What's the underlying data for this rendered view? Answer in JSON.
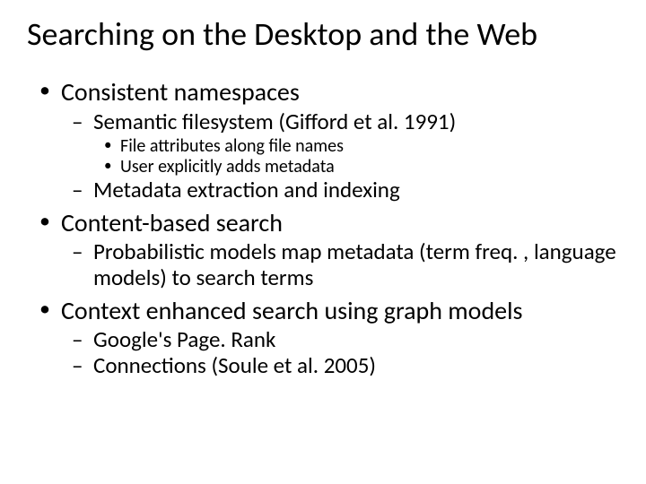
{
  "title": "Searching on the Desktop and the Web",
  "b1": {
    "text": "Consistent namespaces",
    "sub": {
      "s1": {
        "text": "Semantic filesystem (Gifford et al. 1991)",
        "sub": {
          "a": "File attributes along file names",
          "b": "User explicitly adds metadata"
        }
      },
      "s2": {
        "text": "Metadata extraction and indexing"
      }
    }
  },
  "b2": {
    "text": "Content-based search",
    "sub": {
      "s1": {
        "text": "Probabilistic models map metadata (term freq. , language models) to search terms"
      }
    }
  },
  "b3": {
    "text": "Context enhanced search using graph models",
    "sub": {
      "s1": {
        "text": "Google's Page. Rank"
      },
      "s2": {
        "text": "Connections (Soule et al. 2005)"
      }
    }
  }
}
